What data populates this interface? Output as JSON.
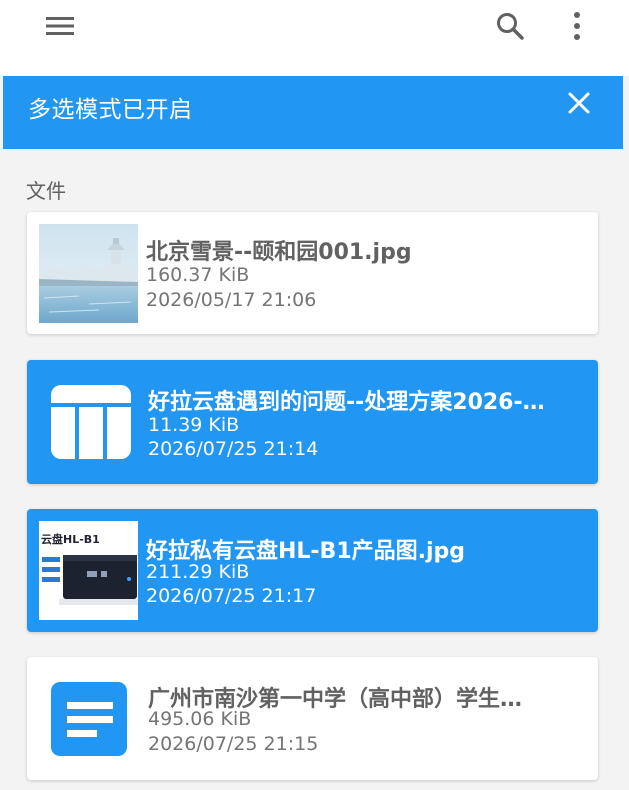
{
  "header": {
    "menu_icon": "menu-icon",
    "search_icon": "search-icon",
    "more_icon": "more-vert-icon"
  },
  "banner": {
    "title": "多选模式已开启",
    "close_icon": "close-icon",
    "color": "#2196f3"
  },
  "section": {
    "label": "文件"
  },
  "files": [
    {
      "name": "北京雪景--颐和园001.jpg",
      "size": "160.37 KiB",
      "date": "2026/05/17 21:06",
      "thumb": "image-thumbnail",
      "selected": false
    },
    {
      "name": "好拉云盘遇到的问题--处理方案2026-…",
      "size": "11.39 KiB",
      "date": "2026/07/25 21:14",
      "thumb": "spreadsheet-icon",
      "selected": true
    },
    {
      "name": "好拉私有云盘HL-B1产品图.jpg",
      "size": "211.29 KiB",
      "date": "2026/07/25 21:17",
      "thumb": "image-thumbnail",
      "thumb_text": "云盘HL-B1",
      "selected": true
    },
    {
      "name": "广州市南沙第一中学（高中部）学生…",
      "size": "495.06 KiB",
      "date": "2026/07/25 21:15",
      "thumb": "document-icon",
      "selected": false
    }
  ]
}
